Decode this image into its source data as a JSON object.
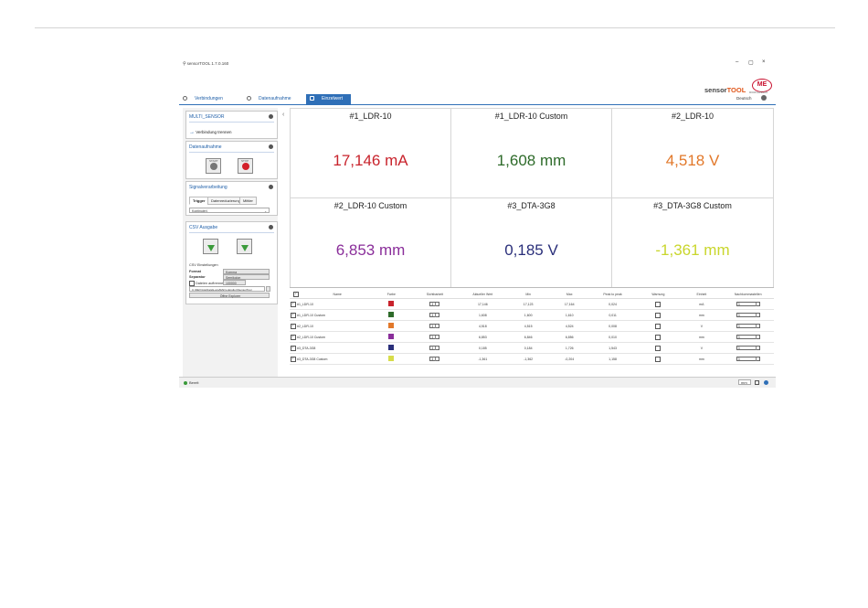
{
  "app": {
    "title": "sensorTOOL 1.7.0.160",
    "controls": [
      "–",
      "▢",
      "×"
    ],
    "logo_part1": "sensor",
    "logo_part2": "TOOL",
    "logo_badge": "ME",
    "logo_sub": "MICRO-EPSILON"
  },
  "tabs": [
    {
      "label": "Verbindungen",
      "active": false
    },
    {
      "label": "Datenaufnahme",
      "active": false
    },
    {
      "label": "Einzelwert",
      "active": true
    }
  ],
  "language": "Deutsch",
  "left": {
    "multi_sensor": {
      "title": "MULTI_SENSOR",
      "action": "Verbindung trennen"
    },
    "datenaufnahme": {
      "title": "Datenaufnahme",
      "start_label": "START",
      "stop_label": "STOP"
    },
    "signal": {
      "title": "Signalverarbeitung",
      "subtabs": [
        "Trigger",
        "Datenreduzierung",
        "Mittler"
      ],
      "trigger_value": "Kontinuierl."
    },
    "csv": {
      "title": "CSV Ausgabe",
      "settings_title": "CSV Einstellungen",
      "format_label": "Format",
      "format_value": "Komma",
      "separator_label": "Separator",
      "separator_value": "Semikolon",
      "split_label": "Dateien auftrennen",
      "split_value": "100000",
      "path": "C:\\DEV\\AppData\\Local\\Micro-Epsilon\\SensorTool",
      "open_label": "Öffne Explorer"
    }
  },
  "status": {
    "text": "Bereit",
    "unit": "mm"
  },
  "tiles": [
    {
      "name": "#1_LDR-10",
      "value": "17,146 mA",
      "color": "#c8232c"
    },
    {
      "name": "#1_LDR-10 Custom",
      "value": "1,608 mm",
      "color": "#2e6b2a"
    },
    {
      "name": "#2_LDR-10",
      "value": "4,518 V",
      "color": "#e2782a"
    },
    {
      "name": "#2_LDR-10 Custom",
      "value": "6,853 mm",
      "color": "#8a2e9a"
    },
    {
      "name": "#3_DTA-3G8",
      "value": "0,185 V",
      "color": "#2a2f7a"
    },
    {
      "name": "#3_DTA-3G8 Custom",
      "value": "-1,361 mm",
      "color": "#c9d62c"
    }
  ],
  "table": {
    "headers": [
      "",
      "Name",
      "Farbe",
      "Sichtbarkeit",
      "Aktueller Wert",
      "Min",
      "Max",
      "Peak to peak",
      "Warnung",
      "Einheit",
      "Nachkommastellen"
    ],
    "rows": [
      {
        "name": "#1_LDR-10",
        "color": "#c8232c",
        "vis": "3",
        "cur": "17,146",
        "min": "17,123",
        "max": "17,164",
        "p2p": "0,024",
        "unit": "mA",
        "dec": "3"
      },
      {
        "name": "#1_LDR-10 Custom",
        "color": "#2e6b2a",
        "vis": "3",
        "cur": "1,608",
        "min": "1,600",
        "max": "1,610",
        "p2p": "0,011",
        "unit": "mm",
        "dec": "3"
      },
      {
        "name": "#2_LDR-10",
        "color": "#e2782a",
        "vis": "3",
        "cur": "4,518",
        "min": "4,515",
        "max": "4,524",
        "p2p": "0,008",
        "unit": "V",
        "dec": "3"
      },
      {
        "name": "#2_LDR-10 Custom",
        "color": "#8a2e9a",
        "vis": "3",
        "cur": "6,853",
        "min": "6,846",
        "max": "6,856",
        "p2p": "0,010",
        "unit": "mm",
        "dec": "3"
      },
      {
        "name": "#3_DTA-3G8",
        "color": "#2a2f7a",
        "vis": "3",
        "cur": "0,185",
        "min": "0,184",
        "max": "1,726",
        "p2p": "1,543",
        "unit": "V",
        "dec": "3"
      },
      {
        "name": "#3_DTA-3G8 Custom",
        "color": "#d7dc4a",
        "vis": "3",
        "cur": "-1,361",
        "min": "-1,362",
        "max": "-0,204",
        "p2p": "1,158",
        "unit": "mm",
        "dec": "3"
      }
    ]
  }
}
